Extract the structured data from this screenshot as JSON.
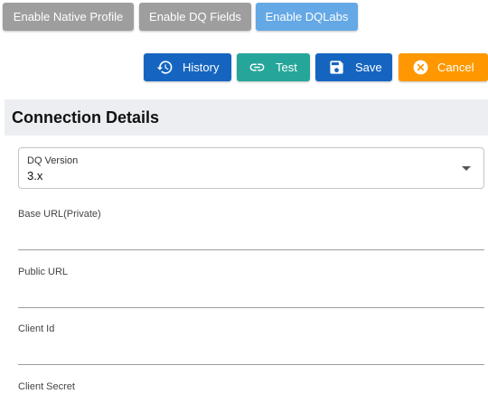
{
  "toggles": {
    "native_profile": "Enable Native Profile",
    "dq_fields": "Enable DQ Fields",
    "dqlabs": "Enable DQLabs"
  },
  "actions": {
    "history": "History",
    "test": "Test",
    "save": "Save",
    "cancel": "Cancel"
  },
  "section": {
    "title": "Connection Details"
  },
  "dq_version": {
    "label": "DQ Version",
    "value": "3.x"
  },
  "fields": {
    "base_url": "Base URL(Private)",
    "public_url": "Public URL",
    "client_id": "Client Id",
    "client_secret": "Client Secret"
  },
  "colors": {
    "toggle_inactive": "#9e9e9e",
    "toggle_active": "#64a8e6",
    "primary": "#1565c0",
    "test": "#26a69a",
    "cancel": "#ff9800",
    "header_bg": "#eceef2"
  },
  "icons": {
    "history": "history-icon",
    "test": "link-icon",
    "save": "save-icon",
    "cancel": "cancel-circle-icon"
  }
}
